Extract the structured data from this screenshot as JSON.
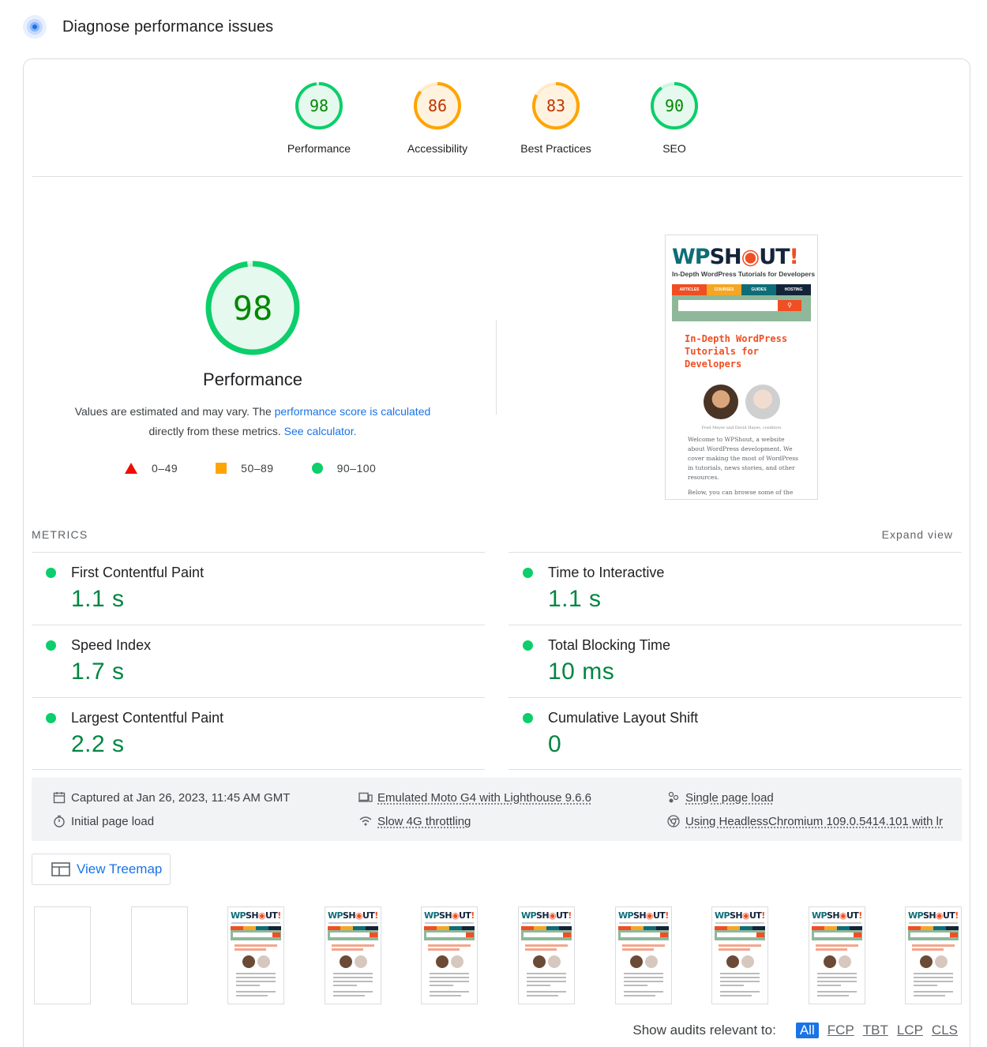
{
  "header": {
    "title": "Diagnose performance issues"
  },
  "categories": [
    {
      "score": "98",
      "label": "Performance",
      "color": "#0cce6b",
      "text_color": "#008800",
      "fill": 0.98
    },
    {
      "score": "86",
      "label": "Accessibility",
      "color": "#ffa400",
      "text_color": "#c33300",
      "fill": 0.86
    },
    {
      "score": "83",
      "label": "Best Practices",
      "color": "#ffa400",
      "text_color": "#c33300",
      "fill": 0.83
    },
    {
      "score": "90",
      "label": "SEO",
      "color": "#0cce6b",
      "text_color": "#008800",
      "fill": 0.9
    }
  ],
  "main_gauge": {
    "score": "98",
    "label": "Performance",
    "fill": 0.98
  },
  "explanation": {
    "text1": "Values are estimated and may vary. The ",
    "link1": "performance score is calculated",
    "text2": "directly from these metrics. ",
    "link2": "See calculator."
  },
  "legend": {
    "fail": "0–49",
    "average": "50–89",
    "pass": "90–100"
  },
  "screenshot": {
    "logo": "WPSHOUT!",
    "tagline": "In-Depth WordPress Tutorials for Developers",
    "nav": [
      "ARTICLES",
      "COURSES",
      "GUIDES",
      "HOSTING"
    ],
    "headline": "In-Depth WordPress Tutorials for Developers",
    "caption": "Fred Meyer and David Hayes, coeditors",
    "body": "Welcome to WPShout, a website about WordPress development. We cover making the most of WordPress in tutorials, news stories, and other resources.",
    "body2": "Below, you can browse some of the great stuff we've published recently."
  },
  "metrics_header": {
    "label": "METRICS",
    "expand": "Expand view"
  },
  "metrics": [
    {
      "name": "First Contentful Paint",
      "value": "1.1 s"
    },
    {
      "name": "Time to Interactive",
      "value": "1.1 s"
    },
    {
      "name": "Speed Index",
      "value": "1.7 s"
    },
    {
      "name": "Total Blocking Time",
      "value": "10 ms"
    },
    {
      "name": "Largest Contentful Paint",
      "value": "2.2 s"
    },
    {
      "name": "Cumulative Layout Shift",
      "value": "0"
    }
  ],
  "info": {
    "captured": "Captured at Jan 26, 2023, 11:45 AM GMT",
    "initial": "Initial page load",
    "emulated": "Emulated Moto G4 with Lighthouse 9.6.6",
    "throttling": "Slow 4G throttling",
    "single": "Single page load",
    "browser": "Using HeadlessChromium 109.0.5414.101 with lr"
  },
  "treemap": {
    "label": "View Treemap"
  },
  "audits": {
    "label": "Show audits relevant to:",
    "chips": [
      "All",
      "FCP",
      "TBT",
      "LCP",
      "CLS"
    ]
  }
}
